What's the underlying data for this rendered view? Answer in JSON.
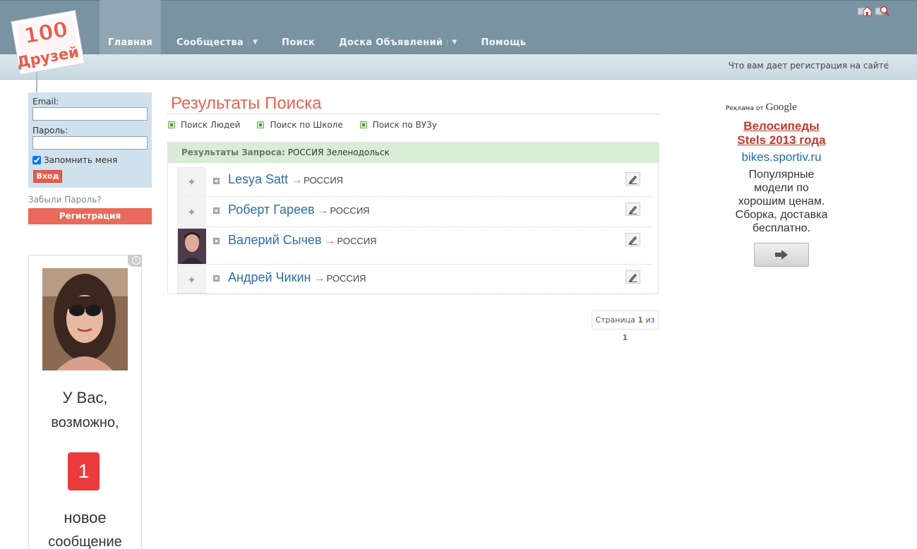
{
  "header": {
    "logo_number": "100",
    "logo_word": "Друзей",
    "nav": [
      {
        "label": "Главная",
        "active": true,
        "dropdown": false
      },
      {
        "label": "Сообщества",
        "active": false,
        "dropdown": true
      },
      {
        "label": "Поиск",
        "active": false,
        "dropdown": false
      },
      {
        "label": "Доска Объявлений",
        "active": false,
        "dropdown": true
      },
      {
        "label": "Помощь",
        "active": false,
        "dropdown": false
      }
    ],
    "icons": [
      "home-icon",
      "search-zoom-icon"
    ],
    "registration_info_link": "Что вам дает регистрация на сайте"
  },
  "login": {
    "email_label": "Email:",
    "email_value": "",
    "password_label": "Пароль:",
    "password_value": "",
    "remember_label": "Запомнить меня",
    "remember_checked": true,
    "enter_button": "Вход",
    "forgot_link": "Забыли Пароль?",
    "register_button": "Регистрация"
  },
  "left_ad": {
    "text_line1": "У Вас,",
    "text_line2": "возможно,",
    "badge_count": "1",
    "text_line3": "новое",
    "text_line4": "сообщение"
  },
  "main": {
    "title": "Результаты Поиска",
    "filters": [
      "Поиск Людей",
      "Поиск по Школе",
      "Поиск по ВУЗу"
    ],
    "results_label": "Результаты Запроса:",
    "results_query": "РОССИЯ Зеленодольск",
    "results": [
      {
        "name": "Lesya Satt",
        "arrow": "→",
        "country": "РОССИЯ",
        "has_photo": false
      },
      {
        "name": "Роберт Гареев",
        "arrow": "→",
        "country": "РОССИЯ",
        "has_photo": false
      },
      {
        "name": "Валерий Сычев",
        "arrow": "→",
        "country": "РОССИЯ",
        "has_photo": true
      },
      {
        "name": "Андрей Чикин",
        "arrow": "→",
        "country": "РОССИЯ",
        "has_photo": false
      }
    ],
    "pager_label": "Страница",
    "pager_current": "1",
    "pager_of": "из",
    "pager_total": "1"
  },
  "right_ad": {
    "ads_by_prefix": "Реклама от",
    "ads_by_brand": "Google",
    "title_line1": "Велосипеды",
    "title_line2": "Stels 2013 года",
    "url": "bikes.sportiv.ru",
    "desc_line1": "Популярные",
    "desc_line2": "модели по",
    "desc_line3": "хорошим ценам.",
    "desc_line4": "Сборка, доставка",
    "desc_line5": "бесплатно."
  },
  "colors": {
    "header_bg": "#7a93a3",
    "accent_red": "#e4634f",
    "link_blue": "#2a6ea6",
    "results_head_bg": "#d9ecd6",
    "login_bg": "#cfe1ec"
  }
}
